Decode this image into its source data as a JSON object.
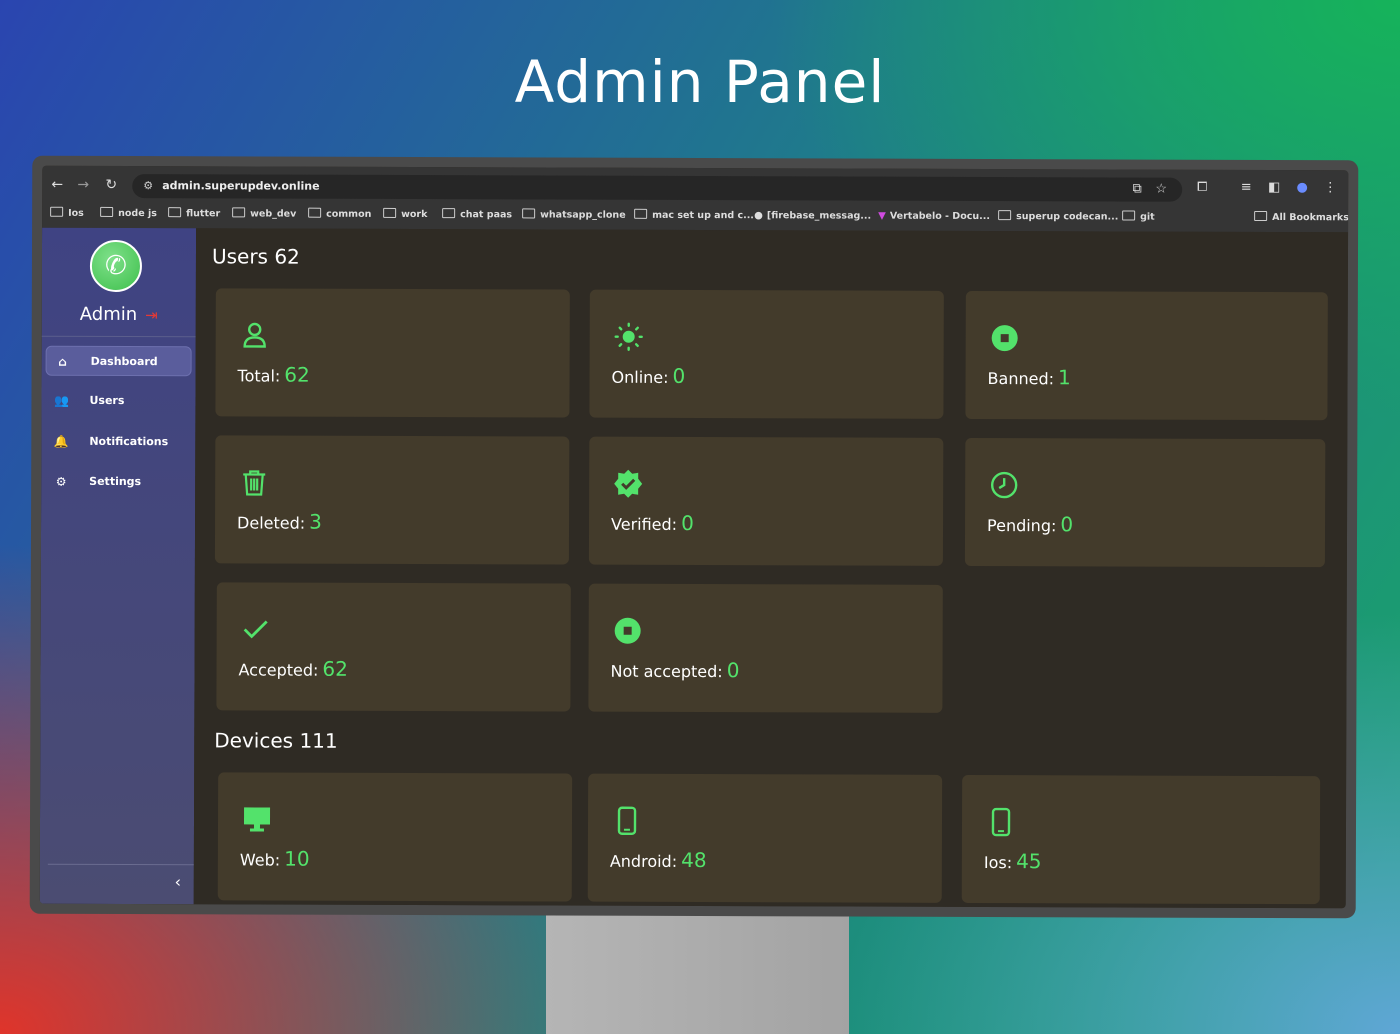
{
  "hero": {
    "title": "Admin Panel"
  },
  "browser": {
    "url": "admin.superupdev.online",
    "bookmarks": [
      "Ios",
      "node js",
      "flutter",
      "web_dev",
      "common",
      "work",
      "chat paas",
      "whatsapp_clone",
      "mac set up and c...",
      "[firebase_messag...",
      "Vertabelo - Docu...",
      "superup codecan...",
      "git"
    ],
    "all_bookmarks": "All Bookmarks"
  },
  "sidebar": {
    "brand": "Admin",
    "items": [
      {
        "label": "Dashboard",
        "icon": "home-icon",
        "active": true
      },
      {
        "label": "Users",
        "icon": "users-icon",
        "active": false
      },
      {
        "label": "Notifications",
        "icon": "notification-add-icon",
        "active": false
      },
      {
        "label": "Settings",
        "icon": "gear-icon",
        "active": false
      }
    ]
  },
  "users": {
    "title": "Users 62",
    "cards": [
      {
        "label": "Total:",
        "value": "62",
        "icon": "user-icon"
      },
      {
        "label": "Online:",
        "value": "0",
        "icon": "sun-icon"
      },
      {
        "label": "Banned:",
        "value": "1",
        "icon": "stop-circle-icon"
      },
      {
        "label": "Deleted:",
        "value": "3",
        "icon": "trash-icon"
      },
      {
        "label": "Verified:",
        "value": "0",
        "icon": "verified-badge-icon"
      },
      {
        "label": "Pending:",
        "value": "0",
        "icon": "clock-icon"
      },
      {
        "label": "Accepted:",
        "value": "62",
        "icon": "check-icon"
      },
      {
        "label": "Not accepted:",
        "value": "0",
        "icon": "stop-circle-icon"
      }
    ]
  },
  "devices": {
    "title": "Devices 111",
    "cards": [
      {
        "label": "Web:",
        "value": "10",
        "icon": "desktop-icon"
      },
      {
        "label": "Android:",
        "value": "48",
        "icon": "phone-icon"
      },
      {
        "label": "Ios:",
        "value": "45",
        "icon": "phone-icon"
      }
    ]
  },
  "colors": {
    "accent_green": "#53e26b",
    "card_bg": "#433b2b",
    "sidebar_bg": "#3f4383",
    "logout_red": "#e53935"
  }
}
